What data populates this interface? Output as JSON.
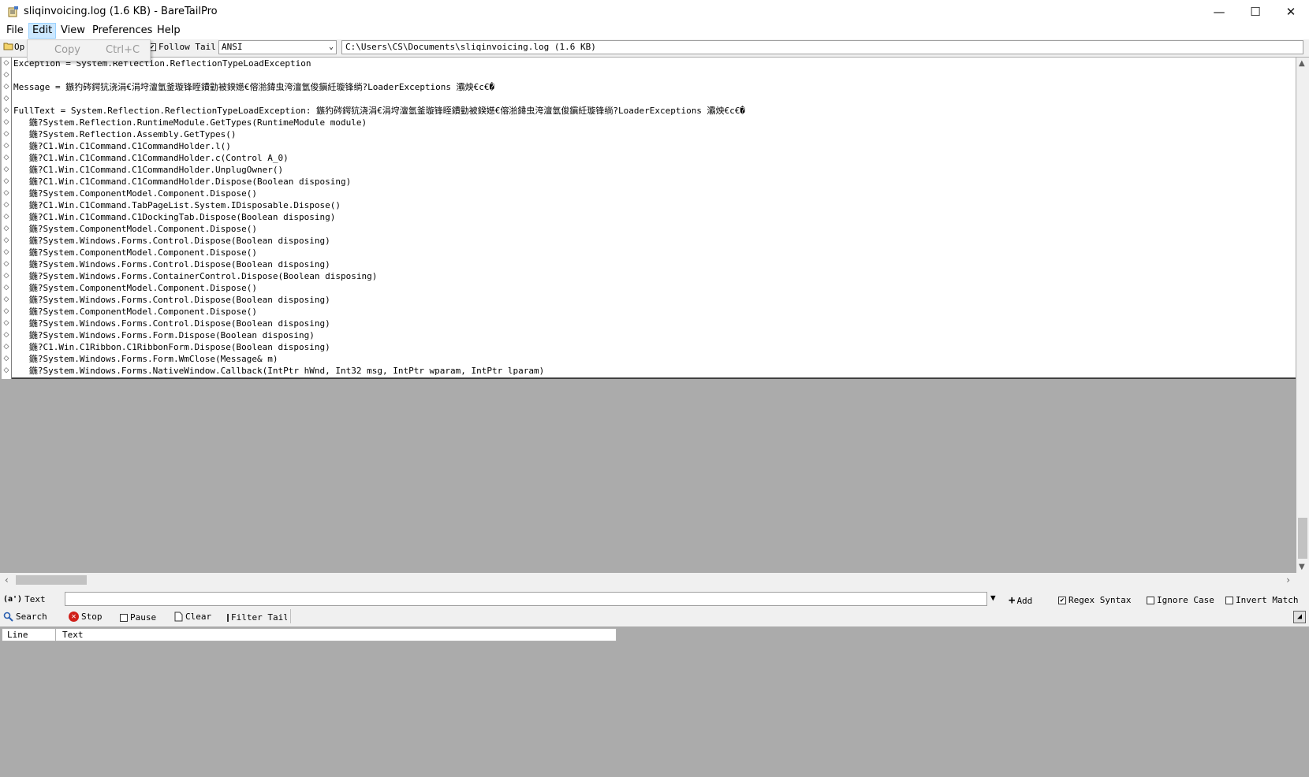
{
  "window": {
    "title": "sliqinvoicing.log (1.6 KB) - BareTailPro",
    "minimize": "—",
    "maximize": "☐",
    "close": "✕"
  },
  "menu": {
    "items": [
      "File",
      "Edit",
      "View",
      "Preferences",
      "Help"
    ],
    "active": "Edit",
    "dropdown": {
      "label": "Copy",
      "accelerator": "Ctrl+C"
    }
  },
  "toolbar": {
    "open_label": "Op",
    "follow_tail_label": "Follow Tail",
    "follow_tail_checked": true,
    "encoding_value": "ANSI",
    "path": "C:\\Users\\CS\\Documents\\sliqinvoicing.log (1.6 KB)"
  },
  "log": {
    "lines": [
      "Exception = System.Reflection.ReflectionTypeLoadException",
      "",
      "Message = 鏃犳硶鍔犺浇涓€涓垨澶氫釜璇锋眰鐨勭被鍨嬨€傛湁鍏虫洿澶氫俊鎭紝璇锋绱?LoaderExceptions 灞炴€с€�",
      "",
      "FullText = System.Reflection.ReflectionTypeLoadException: 鏃犳硶鍔犺浇涓€涓垨澶氫釜璇锋眰鐨勭被鍨嬨€傛湁鍏虫洿澶氫俊鎭紝璇锋绱?LoaderExceptions 灞炴€с€�",
      "   鍦?System.Reflection.RuntimeModule.GetTypes(RuntimeModule module)",
      "   鍦?System.Reflection.Assembly.GetTypes()",
      "   鍦?C1.Win.C1Command.C1CommandHolder.l()",
      "   鍦?C1.Win.C1Command.C1CommandHolder.c(Control A_0)",
      "   鍦?C1.Win.C1Command.C1CommandHolder.UnplugOwner()",
      "   鍦?C1.Win.C1Command.C1CommandHolder.Dispose(Boolean disposing)",
      "   鍦?System.ComponentModel.Component.Dispose()",
      "   鍦?C1.Win.C1Command.TabPageList.System.IDisposable.Dispose()",
      "   鍦?C1.Win.C1Command.C1DockingTab.Dispose(Boolean disposing)",
      "   鍦?System.ComponentModel.Component.Dispose()",
      "   鍦?System.Windows.Forms.Control.Dispose(Boolean disposing)",
      "   鍦?System.ComponentModel.Component.Dispose()",
      "   鍦?System.Windows.Forms.Control.Dispose(Boolean disposing)",
      "   鍦?System.Windows.Forms.ContainerControl.Dispose(Boolean disposing)",
      "   鍦?System.ComponentModel.Component.Dispose()",
      "   鍦?System.Windows.Forms.Control.Dispose(Boolean disposing)",
      "   鍦?System.ComponentModel.Component.Dispose()",
      "   鍦?System.Windows.Forms.Control.Dispose(Boolean disposing)",
      "   鍦?System.Windows.Forms.Form.Dispose(Boolean disposing)",
      "   鍦?C1.Win.C1Ribbon.C1RibbonForm.Dispose(Boolean disposing)",
      "   鍦?System.Windows.Forms.Form.WmClose(Message& m)",
      "   鍦?System.Windows.Forms.NativeWindow.Callback(IntPtr hWnd, Int32 msg, IntPtr wparam, IntPtr lparam)"
    ]
  },
  "filter": {
    "text_label": "Text",
    "input_value": "",
    "add_label": "Add",
    "regex_label": "Regex Syntax",
    "regex_checked": true,
    "ignore_case_label": "Ignore Case",
    "ignore_case_checked": false,
    "invert_label": "Invert Match",
    "invert_checked": false,
    "search_label": "Search",
    "stop_label": "Stop",
    "pause_label": "Pause",
    "clear_label": "Clear",
    "filter_tail_label": "Filter Tail"
  },
  "results": {
    "columns": [
      "Line",
      "Text"
    ]
  },
  "colors": {
    "background": "#ababab",
    "menu_highlight": "#cce8ff",
    "stop_red": "#d0201a"
  }
}
